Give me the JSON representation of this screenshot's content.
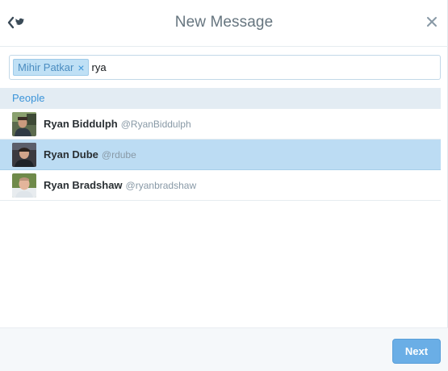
{
  "header": {
    "title": "New Message",
    "back_icon": "chevron-left-twitter-bird-icon",
    "close_icon": "close-icon"
  },
  "search": {
    "token_label": "Mihir Patkar",
    "token_remove": "×",
    "query": "rya"
  },
  "results": {
    "section_label": "People",
    "items": [
      {
        "name": "Ryan Biddulph",
        "handle": "@RyanBiddulph",
        "selected": false
      },
      {
        "name": "Ryan Dube",
        "handle": "@rdube",
        "selected": true
      },
      {
        "name": "Ryan Bradshaw",
        "handle": "@ryanbradshaw",
        "selected": false
      }
    ]
  },
  "footer": {
    "next_label": "Next"
  },
  "colors": {
    "accent": "#3b94d9",
    "selected_row": "#bcdcf3",
    "next_button": "#6aaee6"
  }
}
